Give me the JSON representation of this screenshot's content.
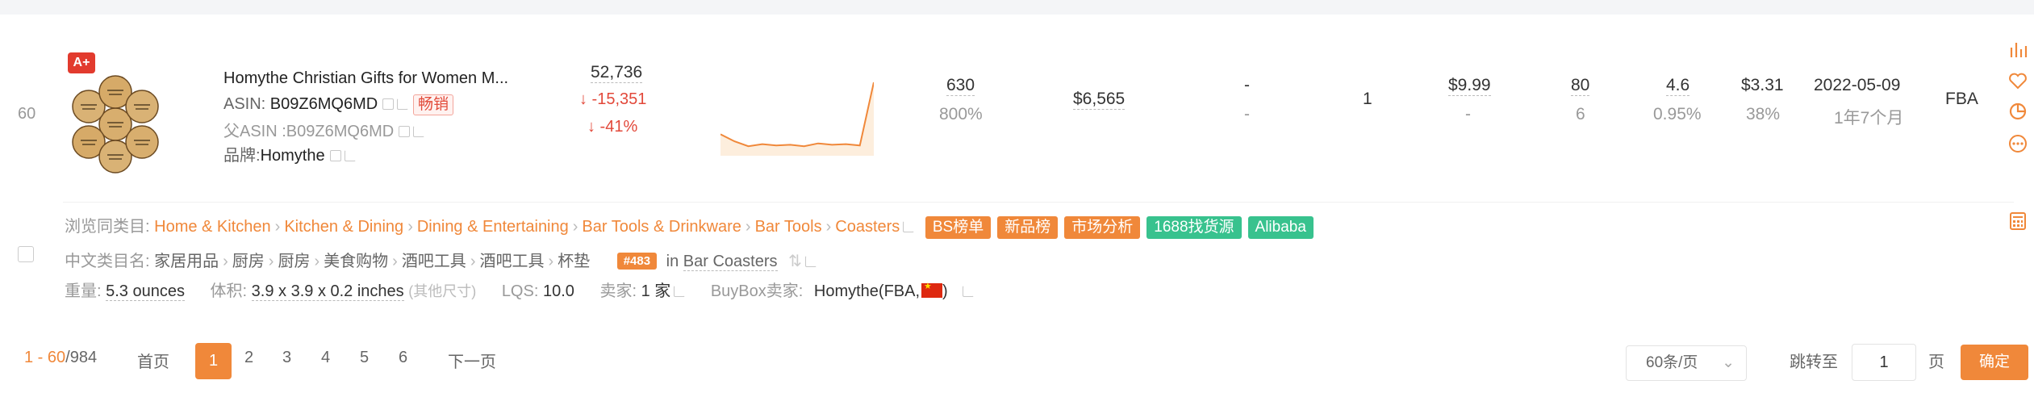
{
  "row": {
    "index": "60",
    "badge": "A+",
    "title": "Homythe Christian Gifts for Women M...",
    "asin_label": "ASIN: ",
    "asin": "B09Z6MQ6MD",
    "hot_label": "畅销",
    "parent_label": "父ASIN :",
    "parent_asin": "B09Z6MQ6MD",
    "brand_label": "品牌:",
    "brand": "Homythe",
    "rank": "52,736",
    "rank_change": "↓ -15,351",
    "rank_change_pct": "↓ -41%",
    "sales_monthly": "630",
    "sales_growth": "800%",
    "revenue": "$6,565",
    "col_dash1": "-",
    "col_dash1_sub": "-",
    "variants": "1",
    "price": "$9.99",
    "price_sub": "-",
    "reviews": "80",
    "reviews_sub": "6",
    "rating": "4.6",
    "rating_sub": "0.95%",
    "fba_fee": "$3.31",
    "fba_fee_pct": "38%",
    "launch_date": "2022-05-09",
    "launch_age": "1年7个月",
    "fulfillment": "FBA",
    "sparkline": [
      0.74,
      0.84,
      0.91,
      0.88,
      0.9,
      0.89,
      0.91,
      0.87,
      0.89,
      0.88,
      0.9,
      0.0
    ],
    "sparkline_color": "#f0883a"
  },
  "category": {
    "label": "浏览同类目:",
    "path": [
      "Home & Kitchen",
      "Kitchen & Dining",
      "Dining & Entertaining",
      "Bar Tools & Drinkware",
      "Bar Tools",
      "Coasters"
    ],
    "tags": [
      {
        "label": "BS榜单",
        "color": "orange"
      },
      {
        "label": "新品榜",
        "color": "orange"
      },
      {
        "label": "市场分析",
        "color": "orange"
      },
      {
        "label": "1688找货源",
        "color": "green"
      },
      {
        "label": "Alibaba",
        "color": "green"
      }
    ]
  },
  "cn_category": {
    "label": "中文类目名:",
    "path": [
      "家居用品",
      "厨房",
      "厨房",
      "美食购物",
      "酒吧工具",
      "酒吧工具",
      "杯垫"
    ],
    "rank": "#483",
    "in": "in",
    "rank_category": "Bar Coasters"
  },
  "attrs": {
    "weight_label": "重量:",
    "weight": "5.3 ounces",
    "volume_label": "体积:",
    "volume": "3.9 x 3.9 x 0.2 inches",
    "volume_note": "(其他尺寸)",
    "lqs_label": "LQS:",
    "lqs": "10.0",
    "sellers_label": "卖家:",
    "sellers": "1 家",
    "buybox_label": "BuyBox卖家:",
    "buybox": "Homythe(FBA,",
    "buybox_close": ")"
  },
  "pagination": {
    "range": "1 - 60",
    "total": "/984",
    "first": "首页",
    "pages": [
      "1",
      "2",
      "3",
      "4",
      "5",
      "6"
    ],
    "next": "下一页",
    "page_size": "60条/页",
    "jump_label": "跳转至",
    "jump_value": "1",
    "page_unit": "页",
    "confirm": "确定"
  },
  "colors": {
    "accent": "#f0883a",
    "green": "#38c28e",
    "down": "#e2483a"
  }
}
